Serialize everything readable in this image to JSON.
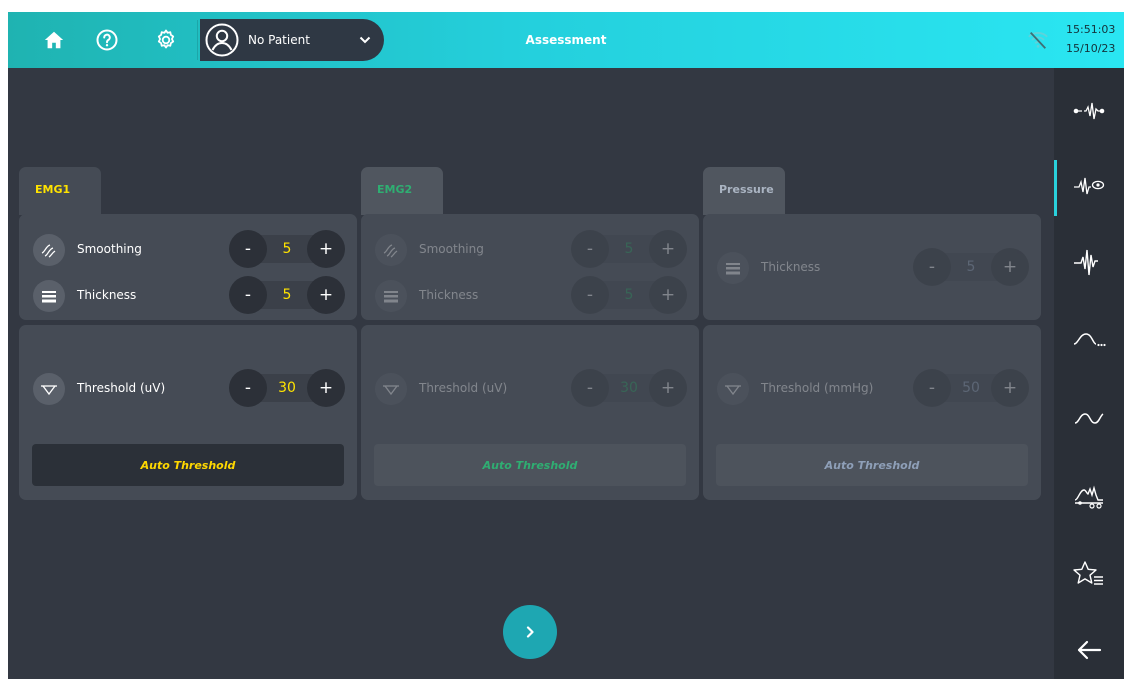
{
  "header": {
    "home_icon": "home-icon",
    "help_icon": "help-icon",
    "settings_icon": "gear-icon",
    "patient": {
      "name": "No Patient",
      "avatar_icon": "user-icon",
      "dropdown_icon": "chevron-down-icon"
    },
    "title": "Assessment",
    "wifi_icon": "wifi-off-icon",
    "time": "15:51:03",
    "date": "15/10/23"
  },
  "panels": {
    "emg1": {
      "tab": "EMG1",
      "smoothing_label": "Smoothing",
      "smoothing_value": "5",
      "thickness_label": "Thickness",
      "thickness_value": "5",
      "threshold_label": "Threshold (uV)",
      "threshold_value": "30",
      "auto_label": "Auto Threshold"
    },
    "emg2": {
      "tab": "EMG2",
      "smoothing_label": "Smoothing",
      "smoothing_value": "5",
      "thickness_label": "Thickness",
      "thickness_value": "5",
      "threshold_label": "Threshold (uV)",
      "threshold_value": "30",
      "auto_label": "Auto Threshold"
    },
    "pressure": {
      "tab": "Pressure",
      "thickness_label": "Thickness",
      "thickness_value": "5",
      "threshold_label": "Threshold (mmHg)",
      "threshold_value": "50",
      "auto_label": "Auto Threshold"
    }
  },
  "stepper": {
    "minus": "-",
    "plus": "+"
  },
  "sidebar": {
    "items": [
      {
        "icon": "electrode-signal-icon",
        "active": false
      },
      {
        "icon": "signal-view-icon",
        "active": true
      },
      {
        "icon": "emg-waveform-icon",
        "active": false
      },
      {
        "icon": "curve-more-icon",
        "active": false
      },
      {
        "icon": "wave-icon",
        "active": false
      },
      {
        "icon": "graph-settings-icon",
        "active": false
      },
      {
        "icon": "favorites-list-icon",
        "active": false
      },
      {
        "icon": "back-arrow-icon",
        "active": false
      }
    ]
  },
  "next_icon": "chevron-right-icon",
  "colors": {
    "accent": "#2ad1dc",
    "value_yellow": "#ffe300",
    "emg2_green": "#2fae72",
    "background": "#333842",
    "card": "#454b55"
  }
}
